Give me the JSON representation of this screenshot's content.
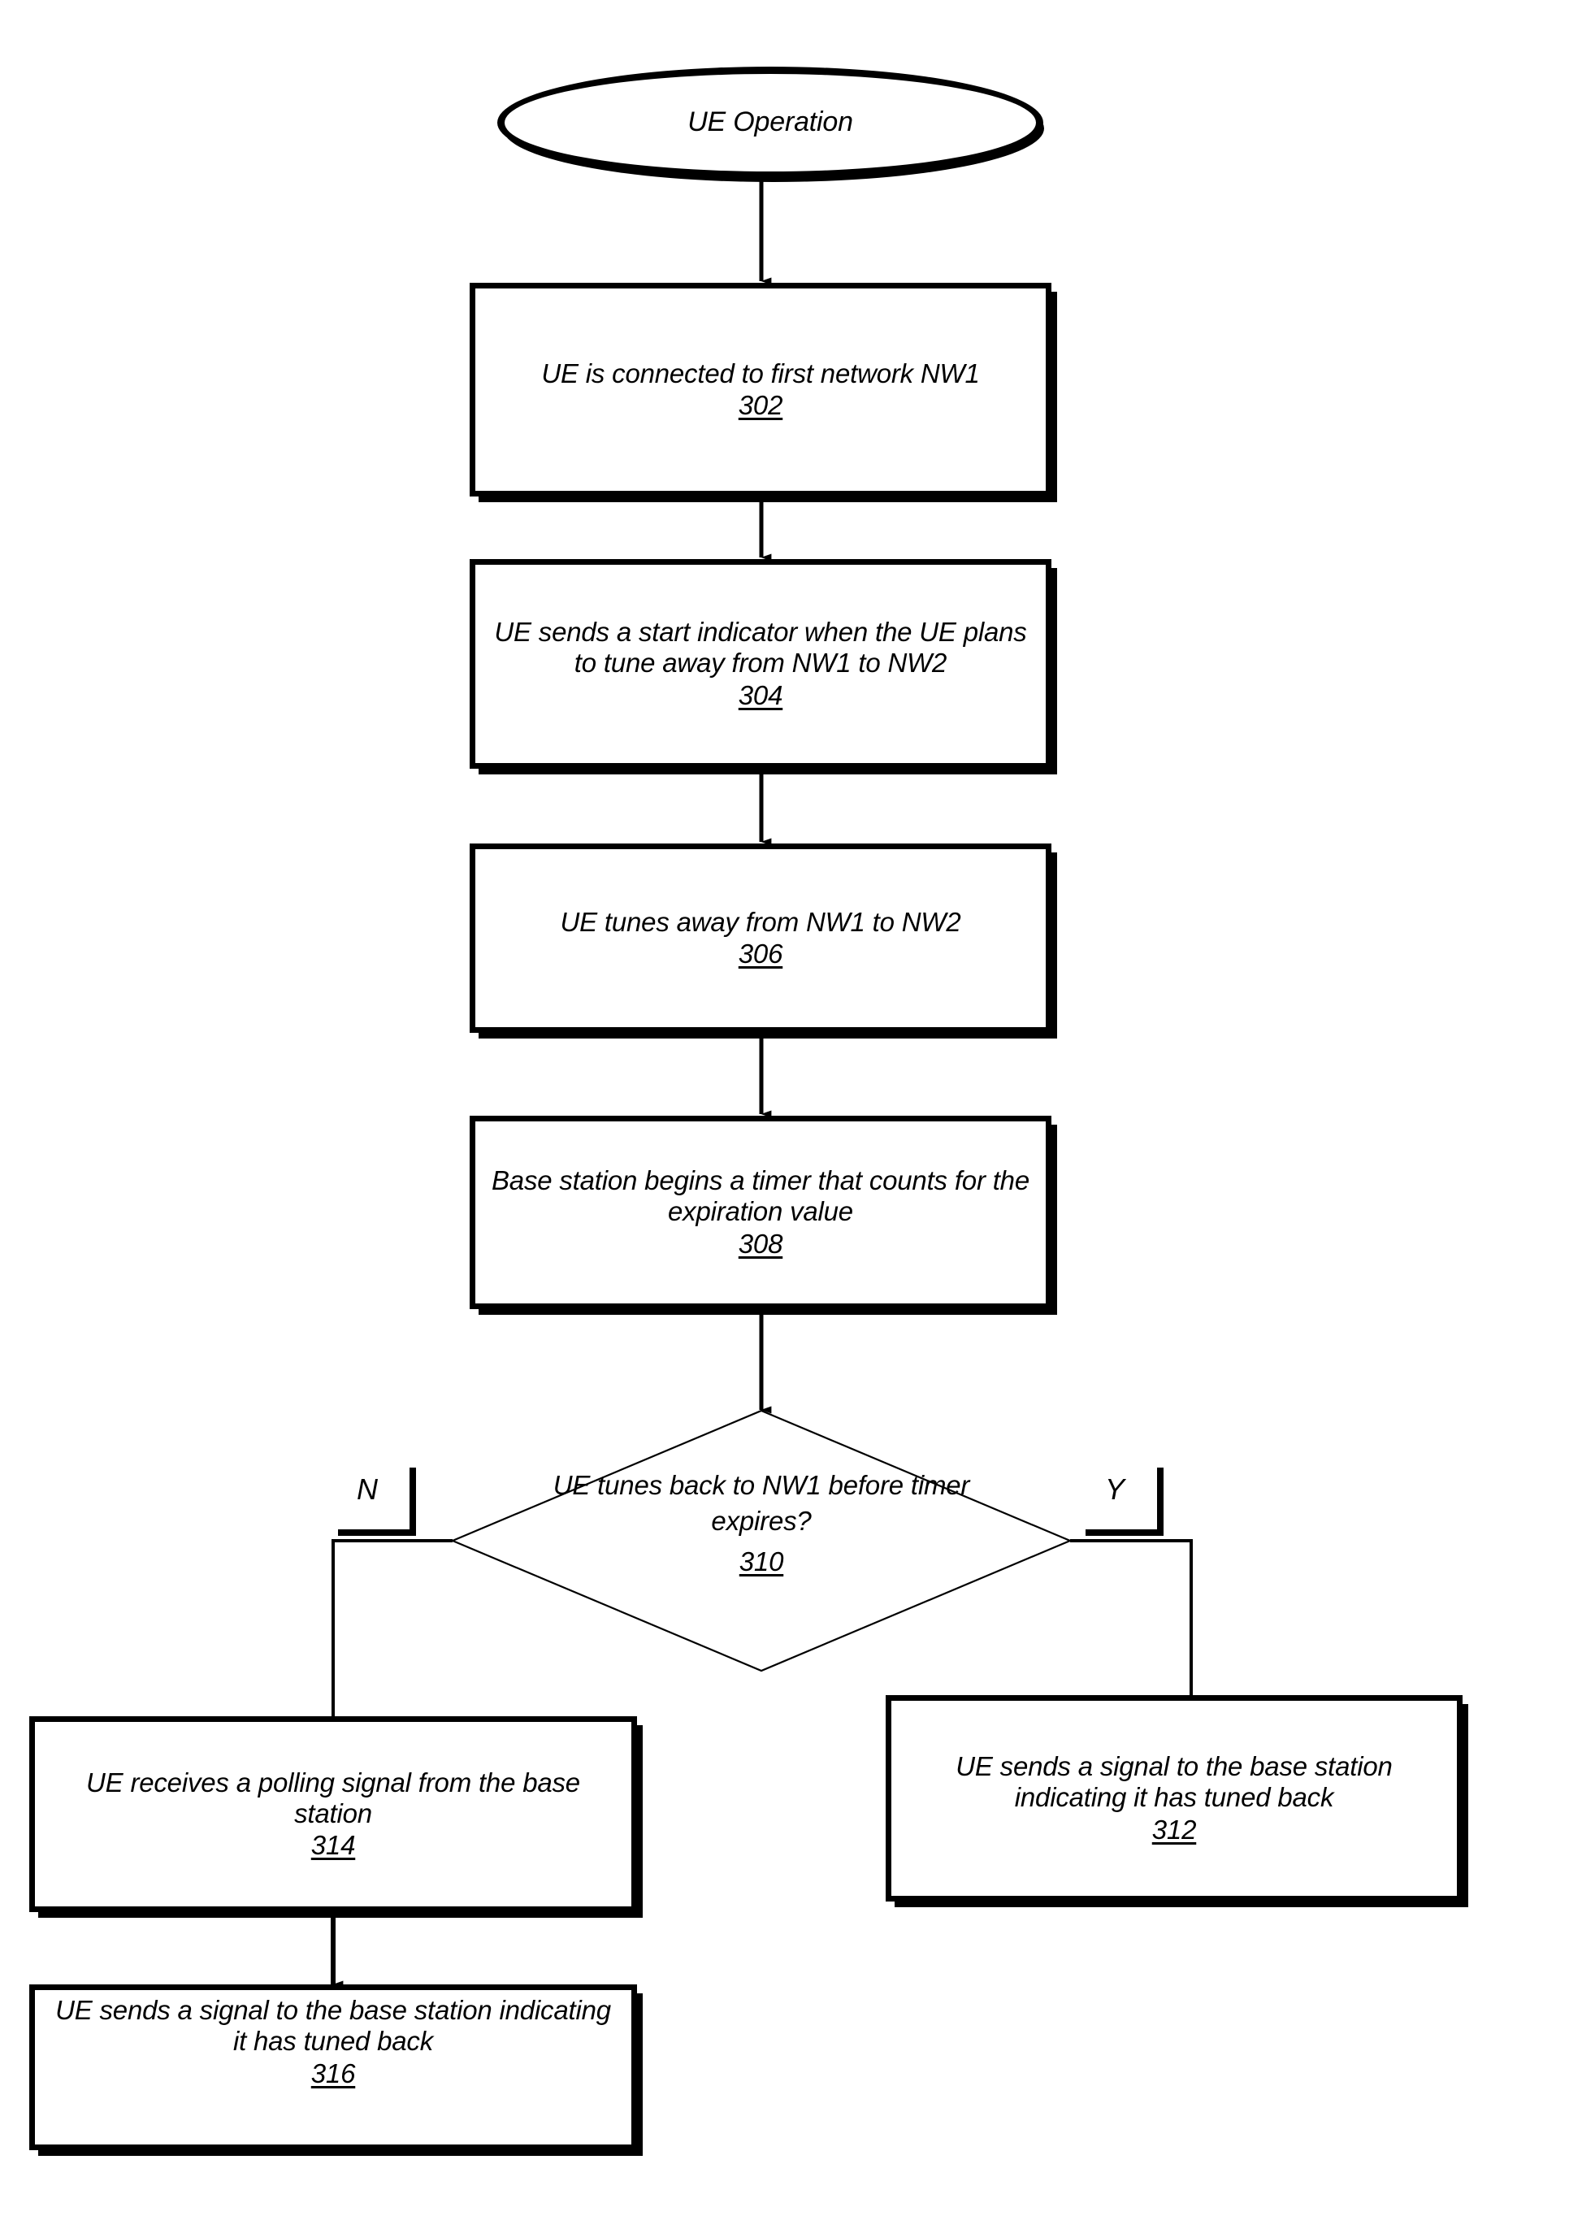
{
  "figure": {
    "title": "UE Operation",
    "orientation": "top-to-bottom"
  },
  "nodes": {
    "start": {
      "shape": "ellipse",
      "text": "UE Operation"
    },
    "n302": {
      "shape": "process",
      "text": "UE is connected to first network NW1",
      "ref": "302"
    },
    "n304": {
      "shape": "process",
      "text": "UE sends a start indicator when the UE plans to tune away from NW1 to NW2",
      "ref": "304"
    },
    "n306": {
      "shape": "process",
      "text": "UE tunes away from NW1 to NW2",
      "ref": "306"
    },
    "n308": {
      "shape": "process",
      "text": "Base station begins a timer that counts for the expiration value",
      "ref": "308"
    },
    "n310": {
      "shape": "decision",
      "text": "UE tunes back to NW1 before timer expires?",
      "ref": "310"
    },
    "n312": {
      "shape": "process",
      "text": "UE sends a signal to the base station indicating it has tuned back",
      "ref": "312"
    },
    "n314": {
      "shape": "process",
      "text": "UE receives a polling signal from the base station",
      "ref": "314"
    },
    "n316": {
      "shape": "process",
      "text": "UE sends a signal to the base station indicating it has tuned back",
      "ref": "316"
    }
  },
  "branches": {
    "no": "N",
    "yes": "Y"
  },
  "colors": {
    "stroke": "#000000",
    "background": "#ffffff"
  }
}
